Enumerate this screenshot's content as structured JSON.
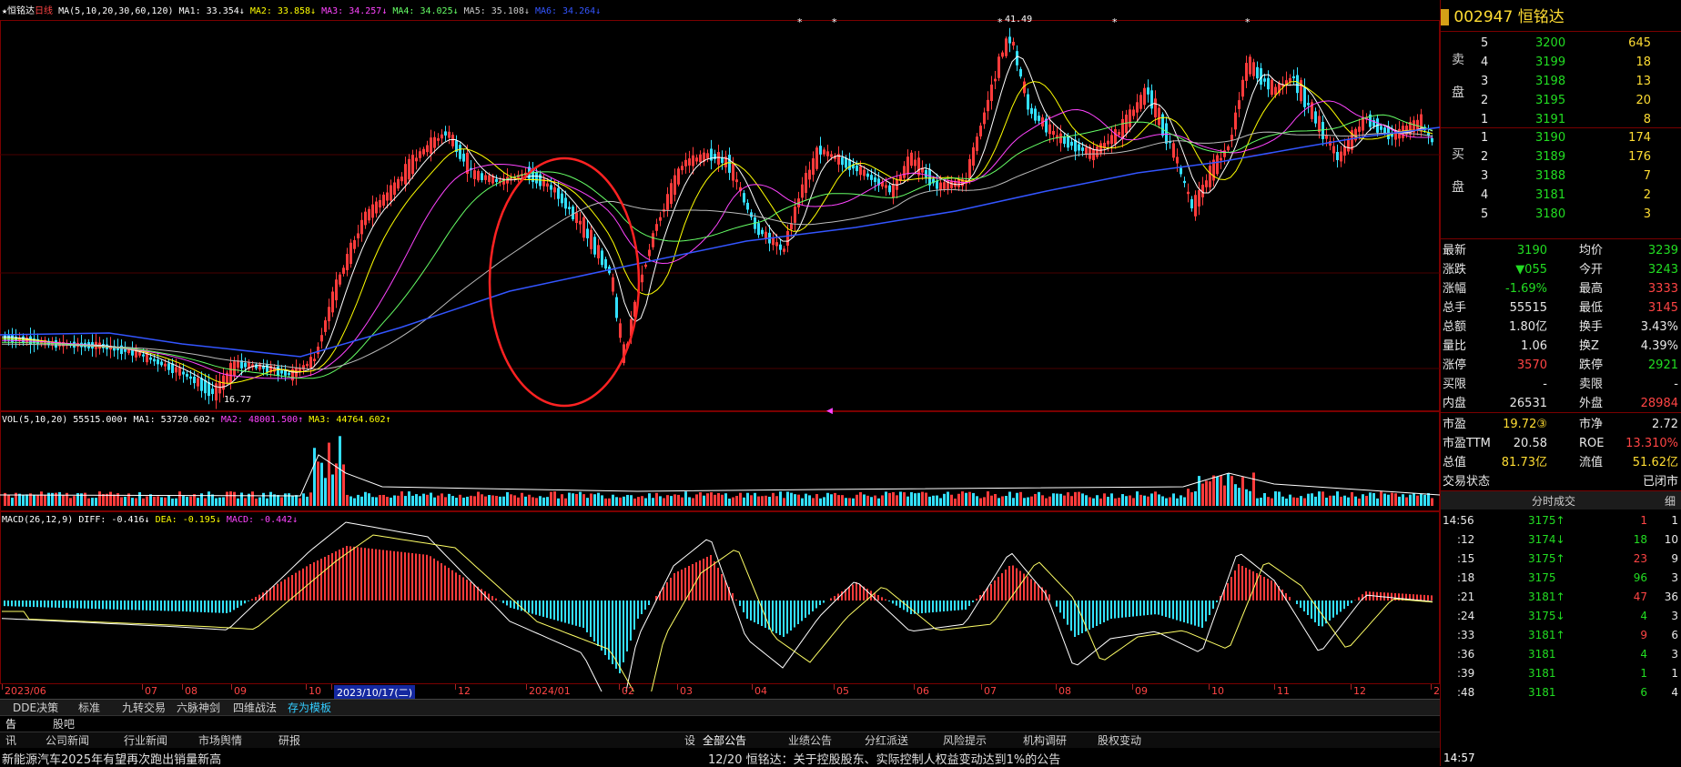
{
  "chart_header": {
    "stock_name": "★恒铭达",
    "period": "日线",
    "ma_label": "MA(5,10,20,30,60,120)",
    "ma1": "MA1: 33.354↓",
    "ma2": "MA2: 33.858↓",
    "ma3": "MA3: 34.257↓",
    "ma4": "MA4: 34.025↓",
    "ma5": "MA5: 35.108↓",
    "ma6": "MA6: 34.264↓",
    "high_label": "41.49",
    "low_label": "16.77"
  },
  "vol_header": {
    "label": "VOL(5,10,20)",
    "value": "55515.000↑",
    "ma1": "MA1: 53720.602↑",
    "ma2": "MA2: 48001.500↑",
    "ma3": "MA3: 44764.602↑"
  },
  "macd_header": {
    "label": "MACD(26,12,9)",
    "diff": "DIFF: -0.416↓",
    "dea": "DEA: -0.195↓",
    "macd": "MACD: -0.442↓"
  },
  "time_axis": [
    "2023/06",
    "07",
    "08",
    "09",
    "10",
    "2023/10/17(二)",
    "12",
    "2024/01",
    "02",
    "03",
    "04",
    "05",
    "06",
    "07",
    "08",
    "09",
    "10",
    "11",
    "12",
    "2"
  ],
  "tool_tabs": [
    "DDE决策",
    "标准",
    "九转交易",
    "六脉神剑",
    "四维战法",
    "存为模板"
  ],
  "news_tabs_left": [
    "告",
    "股吧"
  ],
  "news_tabs_left2": [
    "讯",
    "公司新闻",
    "行业新闻",
    "市场舆情",
    "研报"
  ],
  "news_tabs_right": [
    "设",
    "全部公告",
    "业绩公告",
    "分红派送",
    "风险提示",
    "机构调研",
    "股权变动"
  ],
  "news_left": "新能源汽车2025年有望再次跑出销量新高",
  "news_right": "12/20  恒铭达：关于控股股东、实际控制人权益变动达到1%的公告",
  "right_panel": {
    "code": "002947",
    "name": "恒铭达",
    "sell_label": [
      "卖",
      "盘"
    ],
    "buy_label": [
      "买",
      "盘"
    ],
    "sell": [
      {
        "lvl": "5",
        "price": "3200",
        "vol": "645"
      },
      {
        "lvl": "4",
        "price": "3199",
        "vol": "18"
      },
      {
        "lvl": "3",
        "price": "3198",
        "vol": "13"
      },
      {
        "lvl": "2",
        "price": "3195",
        "vol": "20"
      },
      {
        "lvl": "1",
        "price": "3191",
        "vol": "8"
      }
    ],
    "buy": [
      {
        "lvl": "1",
        "price": "3190",
        "vol": "174"
      },
      {
        "lvl": "2",
        "price": "3189",
        "vol": "176"
      },
      {
        "lvl": "3",
        "price": "3188",
        "vol": "7"
      },
      {
        "lvl": "4",
        "price": "3181",
        "vol": "2"
      },
      {
        "lvl": "5",
        "price": "3180",
        "vol": "3"
      }
    ],
    "stats": [
      {
        "k1": "最新",
        "v1": "3190",
        "k2": "均价",
        "v2": "3239"
      },
      {
        "k1": "涨跌",
        "v1": "▼055",
        "k2": "今开",
        "v2": "3243"
      },
      {
        "k1": "涨幅",
        "v1": "-1.69%",
        "k2": "最高",
        "v2": "3333"
      },
      {
        "k1": "总手",
        "v1": "55515",
        "k2": "最低",
        "v2": "3145"
      },
      {
        "k1": "总额",
        "v1": "1.80亿",
        "k2": "换手",
        "v2": "3.43%"
      },
      {
        "k1": "量比",
        "v1": "1.06",
        "k2": "换Z",
        "v2": "4.39%"
      },
      {
        "k1": "涨停",
        "v1": "3570",
        "k2": "跌停",
        "v2": "2921"
      },
      {
        "k1": "买限",
        "v1": "-",
        "k2": "卖限",
        "v2": "-"
      },
      {
        "k1": "内盘",
        "v1": "26531",
        "k2": "外盘",
        "v2": "28984"
      }
    ],
    "fin": [
      {
        "k1": "市盈",
        "v1": "19.72③",
        "k2": "市净",
        "v2": "2.72"
      },
      {
        "k1": "市盈TTM",
        "v1": "20.58",
        "k2": "ROE",
        "v2": "13.310%"
      },
      {
        "k1": "总值",
        "v1": "81.73亿",
        "k2": "流值",
        "v2": "51.62亿"
      },
      {
        "k1": "交易状态",
        "v1": "",
        "k2": "",
        "v2": "已闭市"
      }
    ],
    "ticks_title": "分时成交",
    "ticks_side": "细",
    "ticks": [
      {
        "t": "14:56",
        "p": "3175↑",
        "v": "1",
        "n": "1"
      },
      {
        "t": ":12",
        "p": "3174↓",
        "v": "18",
        "n": "10"
      },
      {
        "t": ":15",
        "p": "3175↑",
        "v": "23",
        "n": "9"
      },
      {
        "t": ":18",
        "p": "3175",
        "v": "96",
        "n": "3"
      },
      {
        "t": ":21",
        "p": "3181↑",
        "v": "47",
        "n": "36"
      },
      {
        "t": ":24",
        "p": "3175↓",
        "v": "4",
        "n": "3"
      },
      {
        "t": ":33",
        "p": "3181↑",
        "v": "9",
        "n": "6"
      },
      {
        "t": ":36",
        "p": "3181",
        "v": "4",
        "n": "3"
      },
      {
        "t": ":39",
        "p": "3181",
        "v": "1",
        "n": "1"
      },
      {
        "t": ":48",
        "p": "3181",
        "v": "6",
        "n": "4"
      }
    ],
    "ticks_bottom": "14:57"
  },
  "colors": {
    "up": "#ff3b3b",
    "down": "#33e0ff",
    "ma1": "#ffffff",
    "ma2": "#ffff00",
    "ma3": "#ff44ff",
    "ma4": "#66ff66",
    "ma5": "#bbbbbb",
    "ma6": "#3355ff",
    "grid": "#7a0000"
  }
}
